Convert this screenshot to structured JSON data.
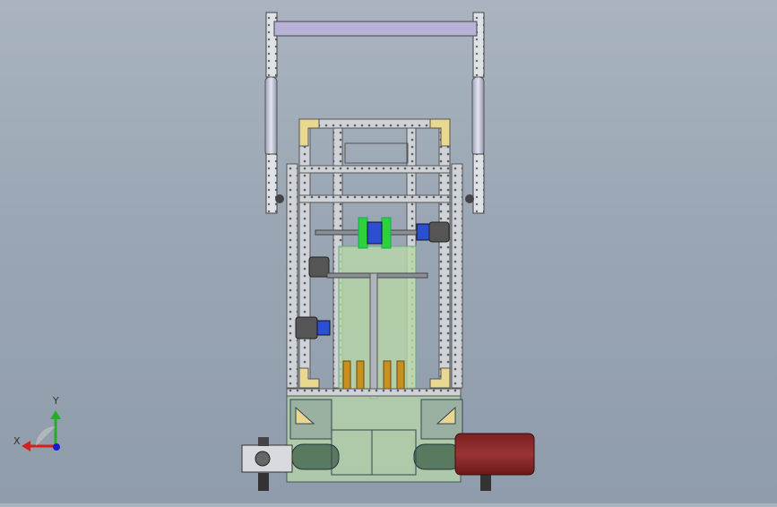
{
  "viewport": {
    "background_top": "#a9b4c0",
    "background_bottom": "#8f9cab",
    "model": "robot-assembly-front-view"
  },
  "triad": {
    "x_label": "X",
    "y_label": "Y",
    "x_color": "#d81e1e",
    "y_color": "#22b022",
    "z_color": "#1a1ad0"
  },
  "colors": {
    "frame": "#cfd3d8",
    "frame_edge": "#555a62",
    "crossbar": "#b9b2d8",
    "plate": "#b8d8a8",
    "gear_green": "#2fd13a",
    "gear_blue": "#2a4fd0",
    "motor": "#555555",
    "bracket_yellow": "#e8d890",
    "hydraulic": "#c8ccd8",
    "motor_red": "#8a2a2a",
    "bronze": "#c8901e"
  }
}
